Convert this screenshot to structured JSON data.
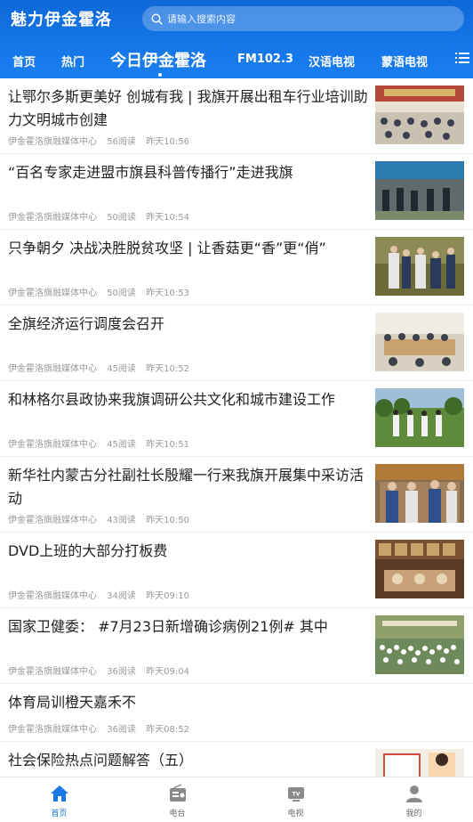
{
  "header": {
    "logo": "魅力伊金霍洛",
    "search_placeholder": "请输入搜索内容"
  },
  "nav": {
    "items": [
      "首页",
      "热门",
      "今日伊金霍洛",
      "FM102.3",
      "汉语电视",
      "蒙语电视"
    ],
    "active": "今日伊金霍洛"
  },
  "articles": [
    {
      "title": "让鄂尔多斯更美好 创城有我 | 我旗开展出租车行业培训助力文明城市创建",
      "source": "伊金霍洛旗融媒体中心",
      "reads": "56阅读",
      "time": "昨天10:56"
    },
    {
      "title": "“百名专家走进盟市旗县科普传播行”走进我旗",
      "source": "伊金霍洛旗融媒体中心",
      "reads": "50阅读",
      "time": "昨天10:54"
    },
    {
      "title": "只争朝夕 决战决胜脱贫攻坚 | 让香菇更“香”更“俏”",
      "source": "伊金霍洛旗融媒体中心",
      "reads": "50阅读",
      "time": "昨天10:53"
    },
    {
      "title": "全旗经济运行调度会召开",
      "source": "伊金霍洛旗融媒体中心",
      "reads": "45阅读",
      "time": "昨天10:52"
    },
    {
      "title": "和林格尔县政协来我旗调研公共文化和城市建设工作",
      "source": "伊金霍洛旗融媒体中心",
      "reads": "45阅读",
      "time": "昨天10:51"
    },
    {
      "title": "新华社内蒙古分社副社长殷耀一行来我旗开展集中采访活动",
      "source": "伊金霍洛旗融媒体中心",
      "reads": "43阅读",
      "time": "昨天10:50"
    },
    {
      "title": "DVD上班的大部分打板费",
      "source": "伊金霍洛旗融媒体中心",
      "reads": "34阅读",
      "time": "昨天09:10"
    },
    {
      "title": "国家卫健委： #7月23日新增确诊病例21例#  其中",
      "source": "伊金霍洛旗融媒体中心",
      "reads": "36阅读",
      "time": "昨天09:04"
    },
    {
      "title": "体育局训橙天嘉禾不",
      "source": "伊金霍洛旗融媒体中心",
      "reads": "36阅读",
      "time": "昨天08:52"
    },
    {
      "title": "社会保险热点问题解答（五）",
      "source": "",
      "reads": "",
      "time": ""
    }
  ],
  "tabbar": {
    "tabs": [
      {
        "label": "首页",
        "icon": "home-icon"
      },
      {
        "label": "电台",
        "icon": "radio-icon"
      },
      {
        "label": "电视",
        "icon": "tv-icon"
      },
      {
        "label": "我的",
        "icon": "user-icon"
      }
    ],
    "active": "首页"
  },
  "colors": {
    "brand": "#1677e5",
    "text": "#222222",
    "meta": "#9a9a9a"
  }
}
